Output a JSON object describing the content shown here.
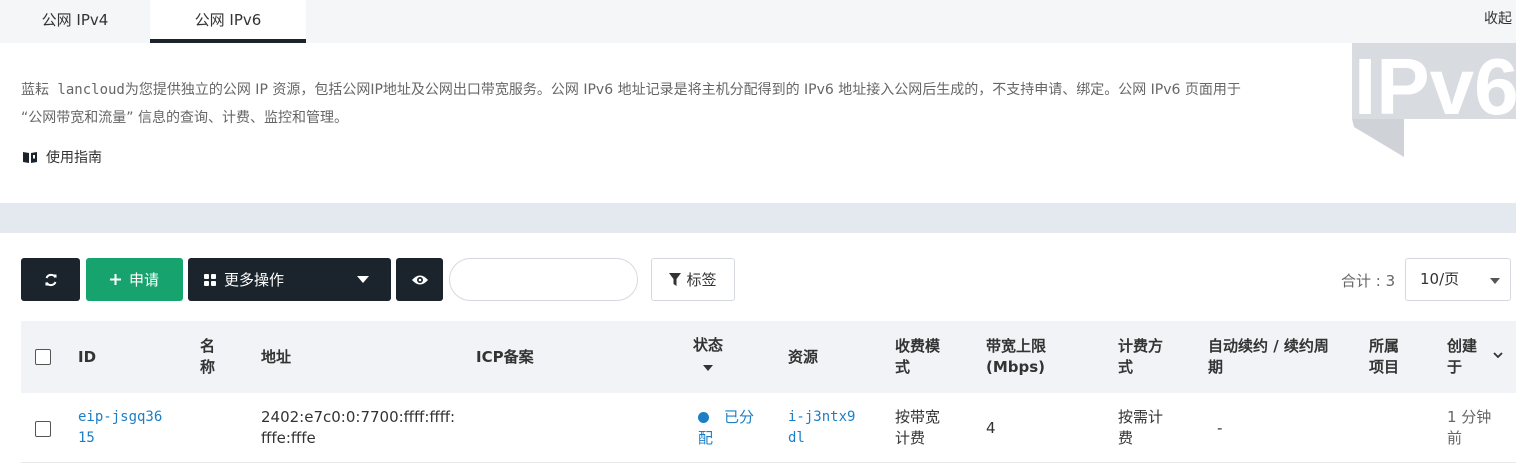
{
  "tabs": [
    {
      "label": "公网 IPv4"
    },
    {
      "label": "公网 IPv6"
    }
  ],
  "collapse_label": "收起",
  "intro": {
    "text_prefix": "蓝耘 lancloud",
    "text": "为您提供独立的公网 IP 资源，包括公网IP地址及公网出口带宽服务。公网 IPv6 地址记录是将主机分配得到的 IPv6 地址接入公网后生成的，不支持申请、绑定。公网 IPv6 页面用于 “公网带宽和流量” 信息的查询、计费、监控和管理。",
    "guide_label": "使用指南",
    "watermark": "IPv6"
  },
  "toolbar": {
    "apply_label": "申请",
    "more_label": "更多操作",
    "search_placeholder": "",
    "tag_label": "标签",
    "total_label": "合计 : 3",
    "page_size": "10/页"
  },
  "table": {
    "columns": {
      "id": "ID",
      "name": "名称",
      "address": "地址",
      "icp": "ICP备案",
      "status": "状态",
      "resource": "资源",
      "billing_mode": "收费模式",
      "bandwidth": "带宽上限 (Mbps)",
      "billing_method": "计费方式",
      "auto_renew": "自动续约 / 续约周期",
      "project": "所属项目",
      "created": "创建于"
    },
    "rows": [
      {
        "id": "eip-jsgq3615",
        "name": "",
        "address": "2402:e7c0:0:7700:ffff:ffff:fffe:fffe",
        "icp": "",
        "status": "已分配",
        "resource": "i-j3ntx9dl",
        "billing_mode": "按带宽计费",
        "bandwidth": "4",
        "billing_method": "按需计费",
        "auto_renew": "-",
        "project": "",
        "created": "1 分钟前"
      }
    ]
  },
  "colors": {
    "primary_dark": "#1b232d",
    "green": "#17a36e",
    "link": "#1c7fc6"
  }
}
